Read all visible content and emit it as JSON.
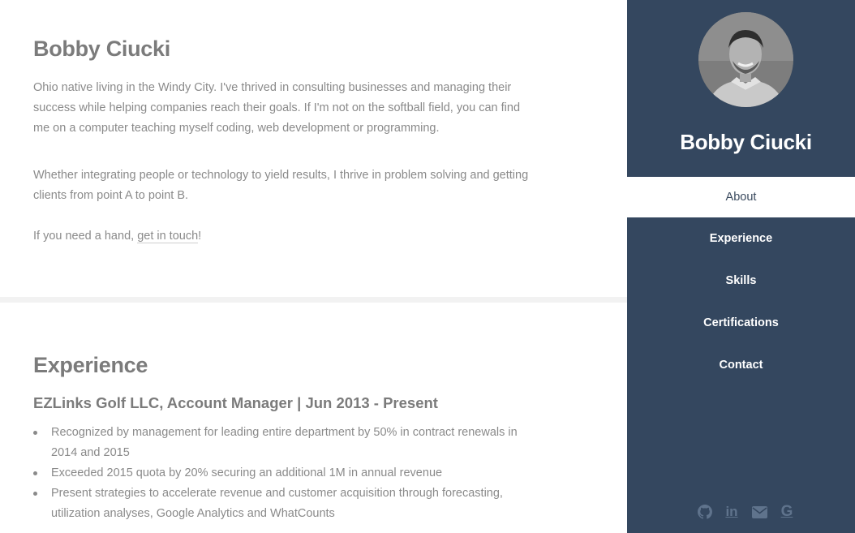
{
  "about": {
    "title": "Bobby Ciucki",
    "paragraph1": "Ohio native living in the Windy City. I've thrived in consulting businesses and managing their success while helping companies reach their goals. If I'm not on the softball field, you can find me on a computer teaching myself coding, web development or programming.",
    "paragraph2": "Whether integrating people or technology to yield results, I thrive in problem solving and getting clients from point A to point B.",
    "paragraph3_prefix": "If you need a hand, ",
    "paragraph3_link": "get in touch",
    "paragraph3_suffix": "!"
  },
  "experience": {
    "title": "Experience",
    "job_title": "EZLinks Golf LLC, Account Manager | Jun 2013 - Present",
    "bullets": [
      "Recognized by management for leading entire department by 50% in contract renewals in 2014 and 2015",
      "Exceeded 2015 quota by 20% securing an additional 1M in annual revenue",
      "Present strategies to accelerate revenue and customer acquisition through forecasting, utilization analyses, Google Analytics and WhatCounts"
    ]
  },
  "sidebar": {
    "name": "Bobby Ciucki",
    "nav": [
      {
        "label": "About",
        "active": true
      },
      {
        "label": "Experience",
        "active": false
      },
      {
        "label": "Skills",
        "active": false
      },
      {
        "label": "Certifications",
        "active": false
      },
      {
        "label": "Contact",
        "active": false
      }
    ],
    "socials": [
      "github-icon",
      "linkedin-icon",
      "email-icon",
      "google-icon"
    ]
  },
  "colors": {
    "sidebar_bg": "#34475f",
    "text": "#8a8a8a",
    "heading": "#7b7b7b",
    "social_icon": "#5f738c"
  }
}
